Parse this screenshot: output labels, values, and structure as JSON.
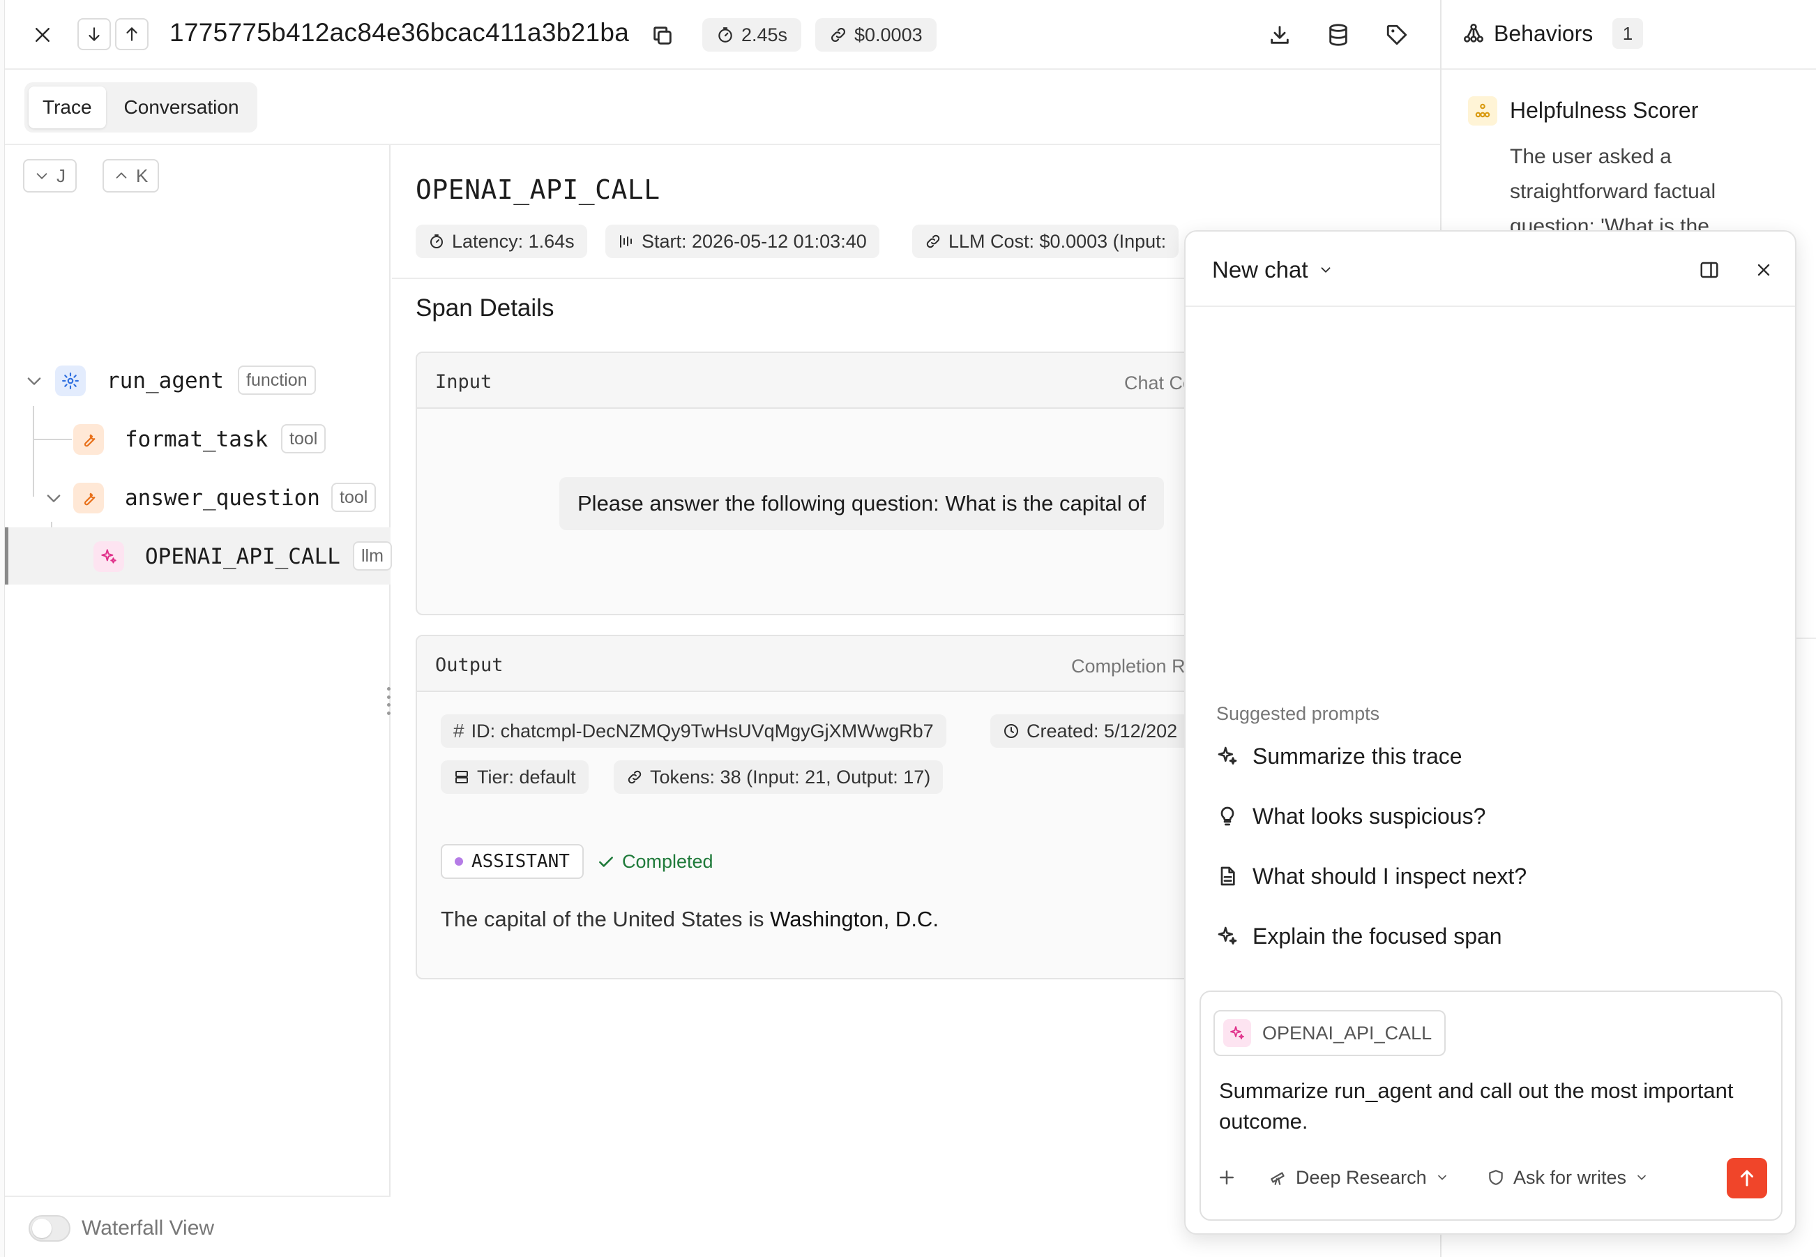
{
  "topbar": {
    "trace_id": "1775775b412ac84e36bcac411a3b21ba",
    "duration": "2.45s",
    "cost": "$0.0003"
  },
  "tabs": [
    {
      "label": "Trace",
      "active": true
    },
    {
      "label": "Conversation",
      "active": false
    }
  ],
  "tree": {
    "nav_down_key": "J",
    "nav_up_key": "K",
    "nodes": [
      {
        "name": "run_agent",
        "badge": "function",
        "icon": "gear-icon"
      },
      {
        "name": "format_task",
        "badge": "tool",
        "icon": "wrench-icon"
      },
      {
        "name": "answer_question",
        "badge": "tool",
        "icon": "wrench-icon"
      },
      {
        "name": "OPENAI_API_CALL",
        "badge": "llm",
        "icon": "sparkle-icon",
        "selected": true
      }
    ],
    "waterfall_label": "Waterfall View"
  },
  "span": {
    "title": "OPENAI_API_CALL",
    "latency": "Latency: 1.64s",
    "start": "Start: 2026-05-12 01:03:40",
    "llm_cost": "LLM Cost: $0.0003 (Input:",
    "details_title": "Span Details",
    "input": {
      "label": "Input",
      "right_label": "Chat Conv",
      "message": "Please answer the following question: What is the capital of"
    },
    "output": {
      "label": "Output",
      "right_label": "Completion R",
      "id": "ID: chatcmpl-DecNZMQy9TwHsUVqMgyGjXMWwgRb7",
      "created": "Created: 5/12/202",
      "tier": "Tier: default",
      "tokens": "Tokens: 38 (Input: 21, Output: 17)",
      "role": "ASSISTANT",
      "status": "Completed",
      "answer_prefix": "The capital of the United States is ",
      "answer_bold": "Washington, D.C."
    }
  },
  "behaviors": {
    "title": "Behaviors",
    "count": "1",
    "scorer_name": "Helpfulness Scorer",
    "scorer_text": "The user asked a straightforward factual question: 'What is the"
  },
  "chat": {
    "title": "New chat",
    "suggested_label": "Suggested prompts",
    "suggestions": [
      {
        "label": "Summarize this trace",
        "icon": "sparkle-icon"
      },
      {
        "label": "What looks suspicious?",
        "icon": "lightbulb-icon"
      },
      {
        "label": "What should I inspect next?",
        "icon": "document-icon"
      },
      {
        "label": "Explain the focused span",
        "icon": "sparkle-icon"
      }
    ],
    "context_chip": "OPENAI_API_CALL",
    "composer_text": "Summarize run_agent and call out the most important outcome.",
    "mode": "Deep Research",
    "permission": "Ask for writes"
  },
  "colors": {
    "accent_send": "#f0452a",
    "status_success": "#1f7a3a",
    "llm_icon_bg": "#fde4f1",
    "tool_icon_bg": "#ffe8d6",
    "function_icon_bg": "#e3ecfd"
  }
}
